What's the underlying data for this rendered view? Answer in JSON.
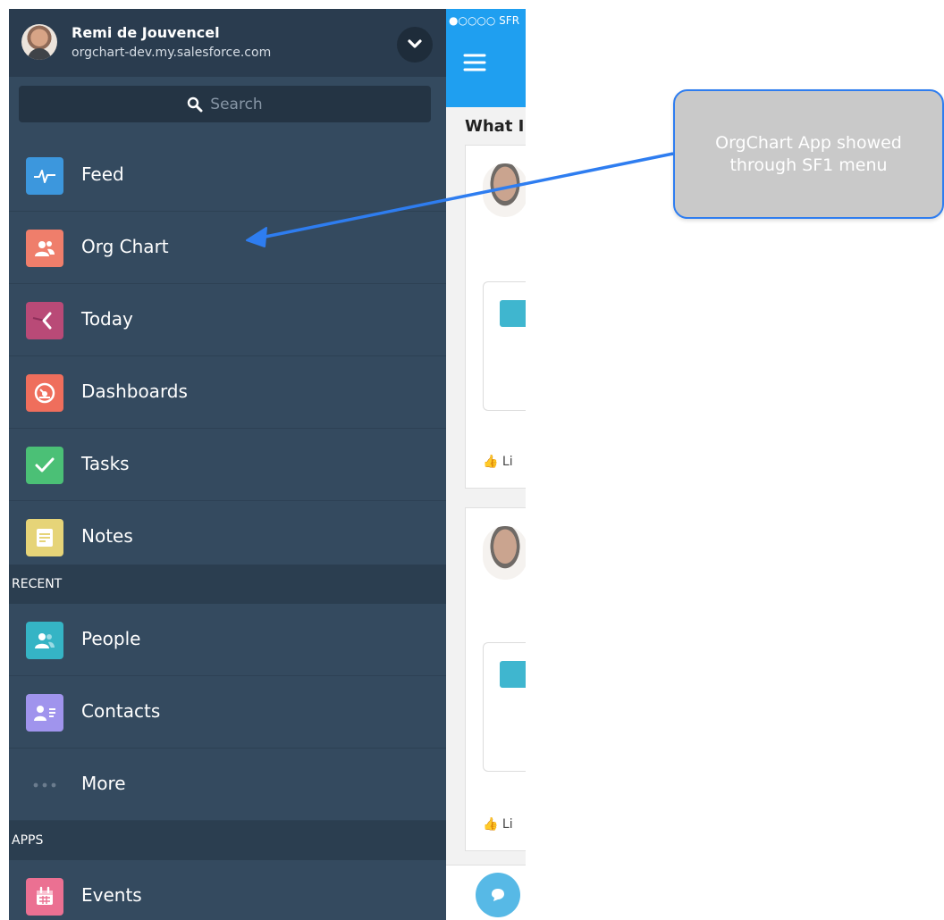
{
  "user": {
    "name": "Remi de Jouvencel",
    "org": "orgchart-dev.my.salesforce.com"
  },
  "search": {
    "placeholder": "Search"
  },
  "menu": {
    "items": [
      {
        "label": "Feed",
        "icon": "feed-icon",
        "color": "#3c97dd"
      },
      {
        "label": "Org Chart",
        "icon": "org-chart-icon",
        "color": "#ef7e6b"
      },
      {
        "label": "Today",
        "icon": "today-icon",
        "color": "#b94a77"
      },
      {
        "label": "Dashboards",
        "icon": "dashboard-icon",
        "color": "#ef6e5c"
      },
      {
        "label": "Tasks",
        "icon": "tasks-icon",
        "color": "#4bc076"
      },
      {
        "label": "Notes",
        "icon": "notes-icon",
        "color": "#e6d478"
      }
    ],
    "recent_header": "RECENT",
    "recent": [
      {
        "label": "People",
        "icon": "people-icon",
        "color": "#35b4c5"
      },
      {
        "label": "Contacts",
        "icon": "contacts-icon",
        "color": "#a094ed"
      },
      {
        "label": "More",
        "icon": "more-icon"
      }
    ],
    "apps_header": "APPS",
    "apps": [
      {
        "label": "Events",
        "icon": "events-icon",
        "color": "#eb7092"
      }
    ]
  },
  "feed_peek": {
    "carrier": "●○○○○ SFR",
    "title": "What I",
    "like_label": "Li"
  },
  "annotation": {
    "text": "OrgChart App showed through SF1 menu",
    "arrow_color": "#2e7df0"
  }
}
